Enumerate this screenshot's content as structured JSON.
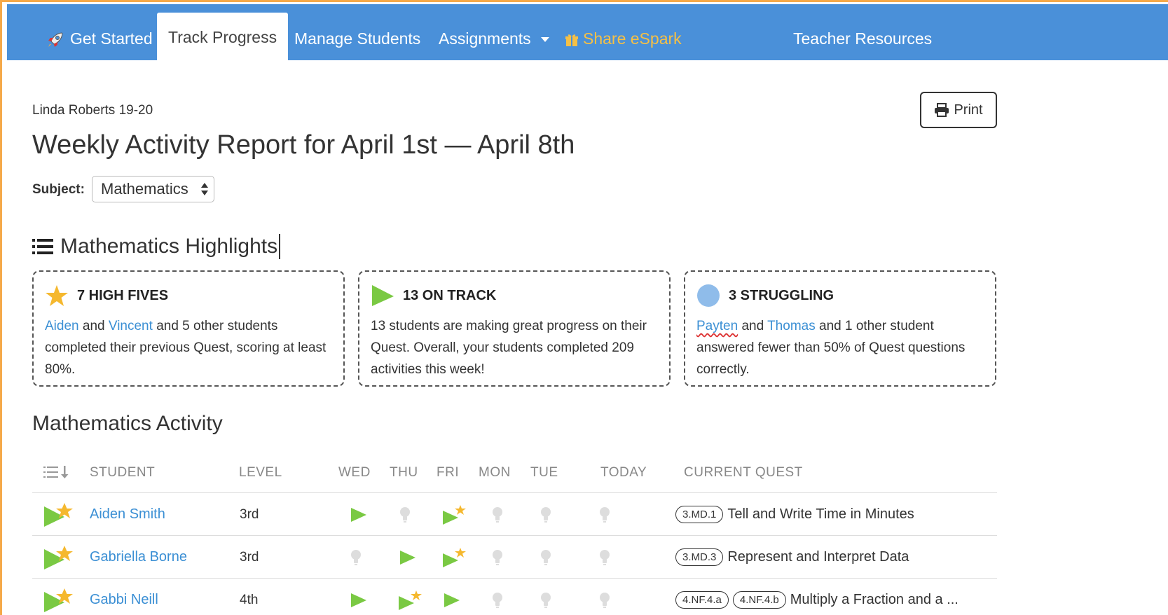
{
  "nav": {
    "items": [
      {
        "label": "Get Started",
        "icon": "rocket-icon"
      },
      {
        "label": "Track Progress",
        "active": true
      },
      {
        "label": "Manage Students"
      },
      {
        "label": "Assignments",
        "icon": "caret-down-icon"
      },
      {
        "label": "Share eSpark",
        "icon": "gift-icon"
      },
      {
        "label": "Teacher Resources"
      }
    ]
  },
  "header": {
    "class_name": "Linda Roberts 19-20",
    "title": "Weekly Activity Report for April 1st — April 8th",
    "print_label": "Print",
    "subject_label": "Subject:",
    "subject_value": "Mathematics"
  },
  "highlights": {
    "title": "Mathematics Highlights",
    "cards": [
      {
        "title": "7 HIGH FIVES",
        "icon": "star-icon",
        "name1": "Aiden",
        "and": "and",
        "name2": "Vincent",
        "rest": "and 5 other students completed their previous Quest, scoring at least 80%."
      },
      {
        "title": "13 ON TRACK",
        "icon": "play-icon",
        "text": "13 students are making great progress on their Quest. Overall, your students completed 209 activities this week!"
      },
      {
        "title": "3 STRUGGLING",
        "icon": "circle-icon",
        "name1": "Payten",
        "and": "and",
        "name2": "Thomas",
        "rest": "and 1 other student answered fewer than 50% of Quest questions correctly."
      }
    ]
  },
  "activity": {
    "title": "Mathematics Activity",
    "columns": [
      "STUDENT",
      "LEVEL",
      "WED",
      "THU",
      "FRI",
      "MON",
      "TUE",
      "TODAY",
      "CURRENT QUEST"
    ],
    "rows": [
      {
        "name": "Aiden Smith",
        "level": "3rd",
        "days": [
          "play",
          "bulb",
          "play-star",
          "bulb",
          "bulb",
          "bulb"
        ],
        "badges": [
          "3.MD.1"
        ],
        "quest": "Tell and Write Time in Minutes"
      },
      {
        "name": "Gabriella Borne",
        "level": "3rd",
        "days": [
          "bulb",
          "play",
          "play-star",
          "bulb",
          "bulb",
          "bulb"
        ],
        "badges": [
          "3.MD.3"
        ],
        "quest": "Represent and Interpret Data"
      },
      {
        "name": "Gabbi Neill",
        "level": "4th",
        "days": [
          "play",
          "play-star",
          "play",
          "bulb",
          "bulb",
          "bulb"
        ],
        "badges": [
          "4.NF.4.a",
          "4.NF.4.b"
        ],
        "quest": "Multiply a Fraction and a ..."
      }
    ]
  },
  "colors": {
    "nav_bg": "#4a90d9",
    "link": "#3b8fd4",
    "green": "#7ac943",
    "star": "#f5b82e",
    "circle": "#8fbcea",
    "frame": "#f5a94a"
  }
}
